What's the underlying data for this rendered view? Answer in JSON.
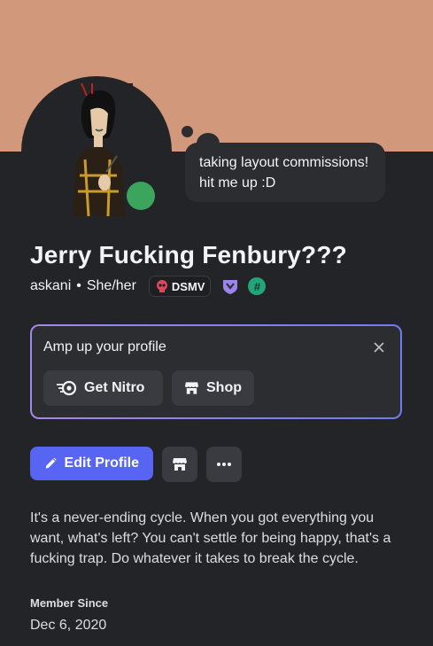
{
  "profile": {
    "display_name": "Jerry Fucking Fenbury???",
    "username": "askani",
    "separator": "•",
    "pronouns": "She/her",
    "guild_tag": "DSMV",
    "custom_status": "taking layout commissions! hit me up :D",
    "status": "online"
  },
  "promo": {
    "title": "Amp up your profile",
    "nitro_label": "Get Nitro",
    "shop_label": "Shop"
  },
  "actions": {
    "edit_label": "Edit Profile",
    "more_label": "···"
  },
  "bio": "It's a never-ending cycle. When you got everything you want, what's left? You can't settle for being happy, that's a fucking trap. Do whatever it takes to break the cycle.",
  "member_since": {
    "label": "Member Since",
    "value": "Dec 6, 2020"
  },
  "badges": {
    "hash_symbol": "#"
  },
  "colors": {
    "banner": "#d2987b",
    "background": "#232428",
    "accent": "#5865f2",
    "online": "#3ba55d"
  }
}
